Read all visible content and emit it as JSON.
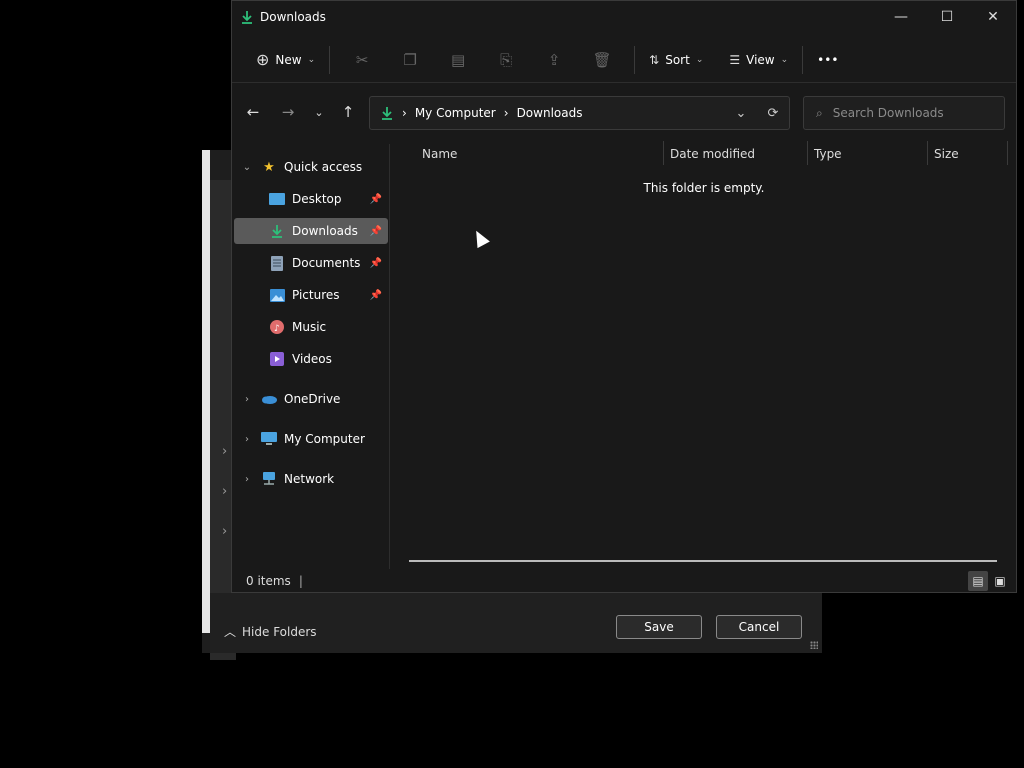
{
  "background_dialog": {
    "hide_folders_label": "Hide Folders",
    "save_label": "Save",
    "cancel_label": "Cancel"
  },
  "window": {
    "title": "Downloads",
    "minimize_glyph": "—",
    "maximize_glyph": "☐",
    "close_glyph": "✕"
  },
  "toolbar": {
    "new_label": "New",
    "sort_label": "Sort",
    "view_label": "View",
    "more_glyph": "•••"
  },
  "address": {
    "crumbs": [
      "My Computer",
      "Downloads"
    ],
    "search_placeholder": "Search Downloads"
  },
  "nav": {
    "quick_access": "Quick access",
    "items": [
      {
        "label": "Desktop",
        "icon": "desktop-icon",
        "pinned": true
      },
      {
        "label": "Downloads",
        "icon": "download-icon",
        "pinned": true,
        "selected": true
      },
      {
        "label": "Documents",
        "icon": "documents-icon",
        "pinned": true
      },
      {
        "label": "Pictures",
        "icon": "pictures-icon",
        "pinned": true
      },
      {
        "label": "Music",
        "icon": "music-icon",
        "pinned": false
      },
      {
        "label": "Videos",
        "icon": "videos-icon",
        "pinned": false
      }
    ],
    "onedrive": "OneDrive",
    "my_computer": "My Computer",
    "network": "Network"
  },
  "columns": [
    "Name",
    "Date modified",
    "Type",
    "Size"
  ],
  "content": {
    "empty_message": "This folder is empty."
  },
  "status": {
    "item_count": "0 items"
  },
  "colors": {
    "accent_green": "#2dbf7a",
    "selected_bg": "#5a5a5a",
    "window_bg": "#191919"
  }
}
